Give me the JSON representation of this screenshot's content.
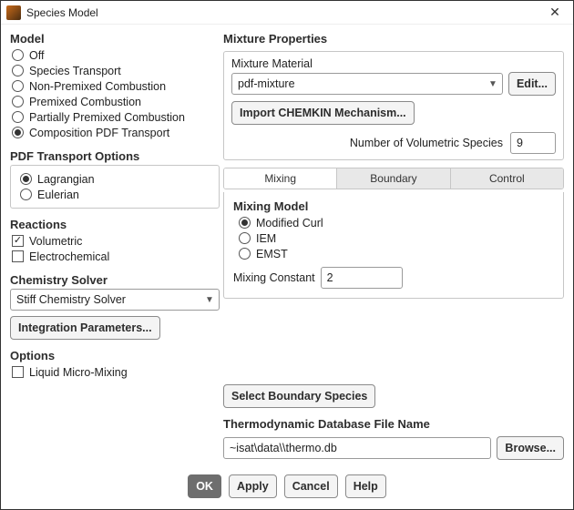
{
  "window": {
    "title": "Species Model"
  },
  "model": {
    "title": "Model",
    "options": [
      "Off",
      "Species Transport",
      "Non-Premixed Combustion",
      "Premixed Combustion",
      "Partially Premixed Combustion",
      "Composition PDF Transport"
    ],
    "selected": "Composition PDF Transport"
  },
  "pdf_transport": {
    "title": "PDF Transport Options",
    "options": [
      "Lagrangian",
      "Eulerian"
    ],
    "selected": "Lagrangian"
  },
  "reactions": {
    "title": "Reactions",
    "items": [
      {
        "label": "Volumetric",
        "checked": true
      },
      {
        "label": "Electrochemical",
        "checked": false
      }
    ]
  },
  "chem_solver": {
    "title": "Chemistry Solver",
    "value": "Stiff Chemistry Solver",
    "integration_btn": "Integration Parameters..."
  },
  "options_panel": {
    "title": "Options",
    "items": [
      {
        "label": "Liquid Micro-Mixing",
        "checked": false
      }
    ]
  },
  "mixture_props": {
    "title": "Mixture Properties",
    "material_label": "Mixture Material",
    "material_value": "pdf-mixture",
    "edit_btn": "Edit...",
    "import_btn": "Import CHEMKIN Mechanism...",
    "numspec_label": "Number of Volumetric Species",
    "numspec_value": "9"
  },
  "tabs": {
    "items": [
      "Mixing",
      "Boundary",
      "Control"
    ],
    "active": "Mixing"
  },
  "mixing_model": {
    "title": "Mixing Model",
    "options": [
      "Modified Curl",
      "IEM",
      "EMST"
    ],
    "selected": "Modified Curl",
    "constant_label": "Mixing Constant",
    "constant_value": "2"
  },
  "boundary_btn": "Select Boundary Species",
  "thermo": {
    "title": "Thermodynamic Database File Name",
    "value": "~isat\\data\\\\thermo.db",
    "browse": "Browse..."
  },
  "footer": {
    "ok": "OK",
    "apply": "Apply",
    "cancel": "Cancel",
    "help": "Help"
  }
}
